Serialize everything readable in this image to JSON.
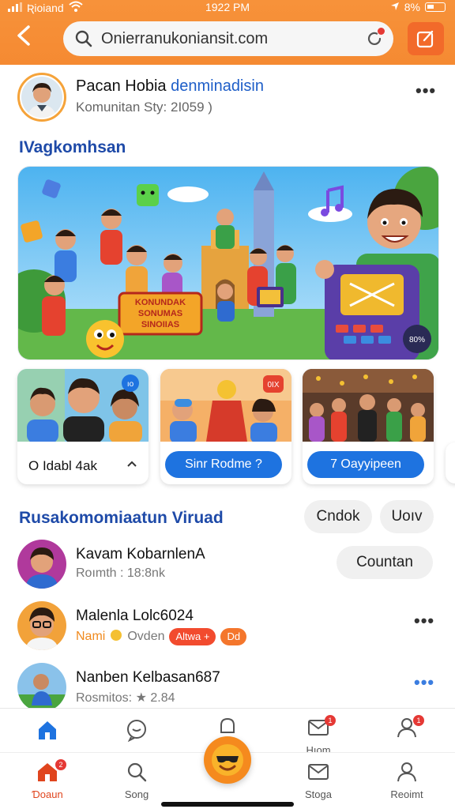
{
  "status": {
    "carrier": "Ʀioiand",
    "time": "1922 PM",
    "battery": "8%"
  },
  "search": {
    "value": "Onierranukoniansit.com"
  },
  "profile": {
    "name": "Pacan Hobia",
    "name_accent": "denminadisin",
    "subtitle": "Komunitan Sty: 2I059 )"
  },
  "section1": {
    "title": "IVagkomhsan"
  },
  "hero": {
    "sign_text_1": "KONUNDAK",
    "sign_text_2": "SONUMAS",
    "sign_text_3": "SINOIIAS",
    "badge": "80%"
  },
  "cards": [
    {
      "label": "O Idabl 4ak",
      "badge": "ıo"
    },
    {
      "label": "Sinr Rodme ?",
      "badge": "0IX"
    },
    {
      "label": "7 Oayyipeen"
    }
  ],
  "section2": {
    "title": "Rusakomomiaatun Viruad",
    "chip1": "Cndok",
    "chip2": "Uoıv"
  },
  "list": [
    {
      "name": "Kavam KobarnlenA",
      "sub": "Roımth : 18:8nk",
      "action": "Countan"
    },
    {
      "name": "Malenla Lolc6024",
      "sub_orange": "Nami",
      "sub_rest": "Ovden",
      "badge1": "Altwa +",
      "badge2": "Dd"
    },
    {
      "name": "Nanben Kelbasan687",
      "sub": "Rosmitos: ★ 2.84"
    }
  ],
  "tabs_top": [
    {
      "label": ""
    },
    {
      "label": ""
    },
    {
      "label": ""
    },
    {
      "label": "Hıom"
    },
    {
      "label": ""
    }
  ],
  "tabs": [
    {
      "label": "Ɗoaun"
    },
    {
      "label": "Song"
    },
    {
      "label": "Stoga"
    },
    {
      "label": "Reoimt"
    }
  ],
  "colors": {
    "brand": "#f58a32",
    "accent_blue": "#1e73e0",
    "title_blue": "#1e4aa8"
  }
}
